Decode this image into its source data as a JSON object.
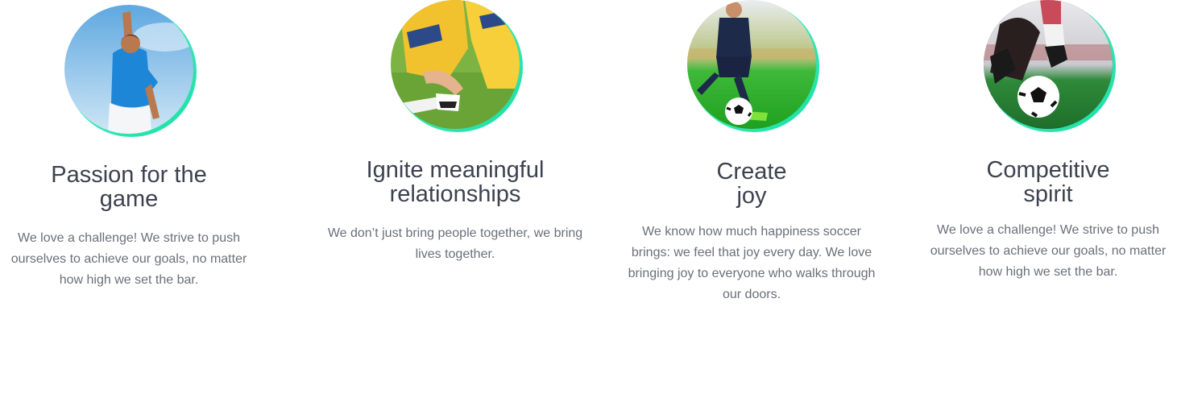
{
  "features": [
    {
      "image": "athlete-celebrating-photo",
      "title_lines": [
        "Passion for the",
        "game"
      ],
      "description": "We love a challenge! We strive to push ourselves to achieve our goals, no matter how high we set the bar."
    },
    {
      "image": "teammates-helping-photo",
      "title_lines": [
        "Ignite meaningful",
        "relationships"
      ],
      "description": "We don’t just bring people together, we bring lives together."
    },
    {
      "image": "player-dribbling-photo",
      "title_lines": [
        "Create",
        "joy"
      ],
      "description": "We know how much happiness soccer brings: we feel that joy every day. We love bringing joy to everyone who walks through our doors."
    },
    {
      "image": "ball-under-foot-photo",
      "title_lines": [
        "Competitive",
        "spirit"
      ],
      "description": "We love a challenge! We strive to push ourselves to achieve our goals, no matter how high we set the bar."
    }
  ],
  "colors": {
    "accent_ring": "#17e0a3",
    "title": "#3d4250",
    "body": "#6a6f7a"
  }
}
